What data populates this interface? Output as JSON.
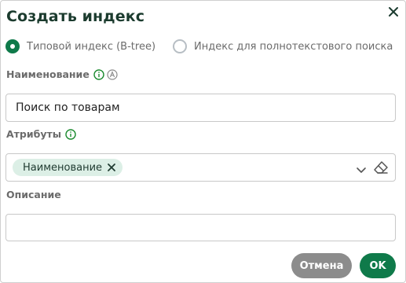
{
  "dialog": {
    "title": "Создать индекс"
  },
  "index_type": {
    "options": [
      {
        "label": "Типовой индекс (B-tree)",
        "selected": true
      },
      {
        "label": "Индекс для полнотекстового поиска",
        "selected": false
      }
    ]
  },
  "name_field": {
    "label": "Наименование",
    "value": "Поиск по товарам"
  },
  "attributes_field": {
    "label": "Атрибуты",
    "chips": [
      "Наименование"
    ]
  },
  "description_field": {
    "label": "Описание",
    "value": ""
  },
  "footer": {
    "cancel_label": "Отмена",
    "ok_label": "OK"
  },
  "colors": {
    "accent": "#0f7a4a",
    "chip_bg": "#dcefe6",
    "cancel_bg": "#8c8c8c",
    "title": "#1b3b2e"
  },
  "icons": {
    "close": "close-icon",
    "info": "info-icon",
    "auto": "letter-a-circle-icon",
    "chevron": "chevron-down-icon",
    "clear": "eraser-icon",
    "chip_remove": "chip-remove-icon"
  }
}
